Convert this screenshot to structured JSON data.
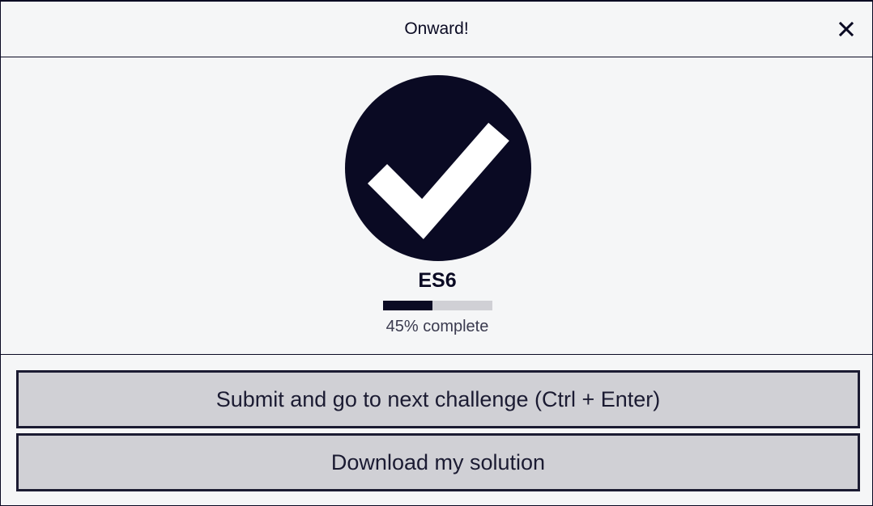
{
  "modal": {
    "title": "Onward!",
    "close_icon": "close-icon"
  },
  "completion": {
    "icon": "checkmark-circle-icon",
    "certification": "ES6",
    "progress_percent": 45,
    "progress_text": "45% complete"
  },
  "actions": {
    "submit_label": "Submit and go to next challenge (Ctrl + Enter)",
    "download_label": "Download my solution"
  },
  "colors": {
    "primary": "#0a0a23",
    "button_bg": "#d0d0d5",
    "background": "#f5f6f7"
  }
}
